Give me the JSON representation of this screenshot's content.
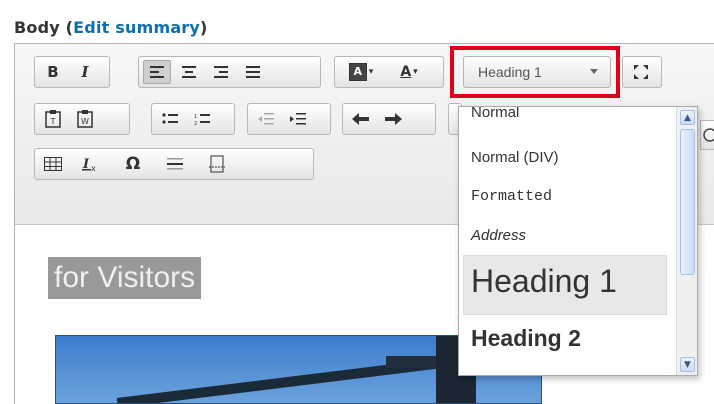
{
  "field": {
    "label": "Body",
    "link": "Edit summary"
  },
  "toolbar": {
    "row1": [
      "B",
      "I",
      "≡",
      "≡",
      "≡",
      "≡",
      "A",
      "A"
    ],
    "row2": [
      "paste-text-icon",
      "paste-word-icon",
      "bulleted-list-icon",
      "numbered-list-icon",
      "outdent-icon",
      "indent-icon",
      "undo-icon",
      "redo-icon"
    ],
    "row3": [
      "table-icon",
      "remove-format-icon",
      "Ω",
      "horizontal-line-icon",
      "page-break-icon"
    ],
    "format_value": "Heading 1"
  },
  "format_menu": {
    "items": [
      "Normal",
      "Normal (DIV)",
      "Formatted",
      "Address",
      "Heading 1",
      "Heading 2"
    ],
    "selected": "Heading 1"
  },
  "content": {
    "heading_text": "for Visitors"
  },
  "colors": {
    "highlight": "#e0001b",
    "link": "#0b6fb0",
    "selection": "#999999"
  }
}
